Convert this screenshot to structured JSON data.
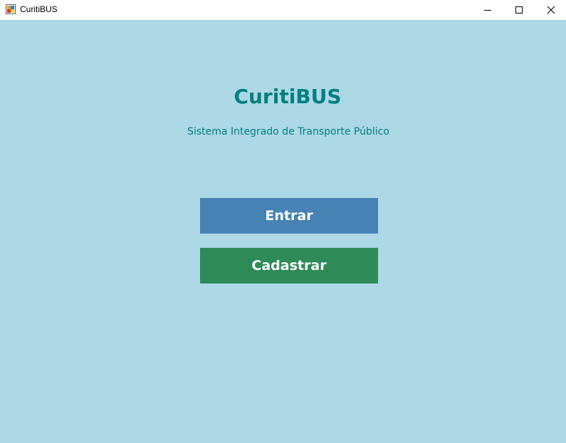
{
  "window": {
    "title": "CuritiBUS",
    "icon": "app-window-icon",
    "controls": [
      "minimize-icon",
      "maximize-icon",
      "close-icon"
    ]
  },
  "main": {
    "title": "CuritiBUS",
    "subtitle": "Sistema Integrado de Transporte Público",
    "buttons": {
      "entrar": "Entrar",
      "cadastrar": "Cadastrar"
    }
  },
  "colors": {
    "background": "#add8e6",
    "title": "#008080",
    "entrar_button": "#4682b4",
    "cadastrar_button": "#2e8b57",
    "button_text": "#ffffff"
  }
}
